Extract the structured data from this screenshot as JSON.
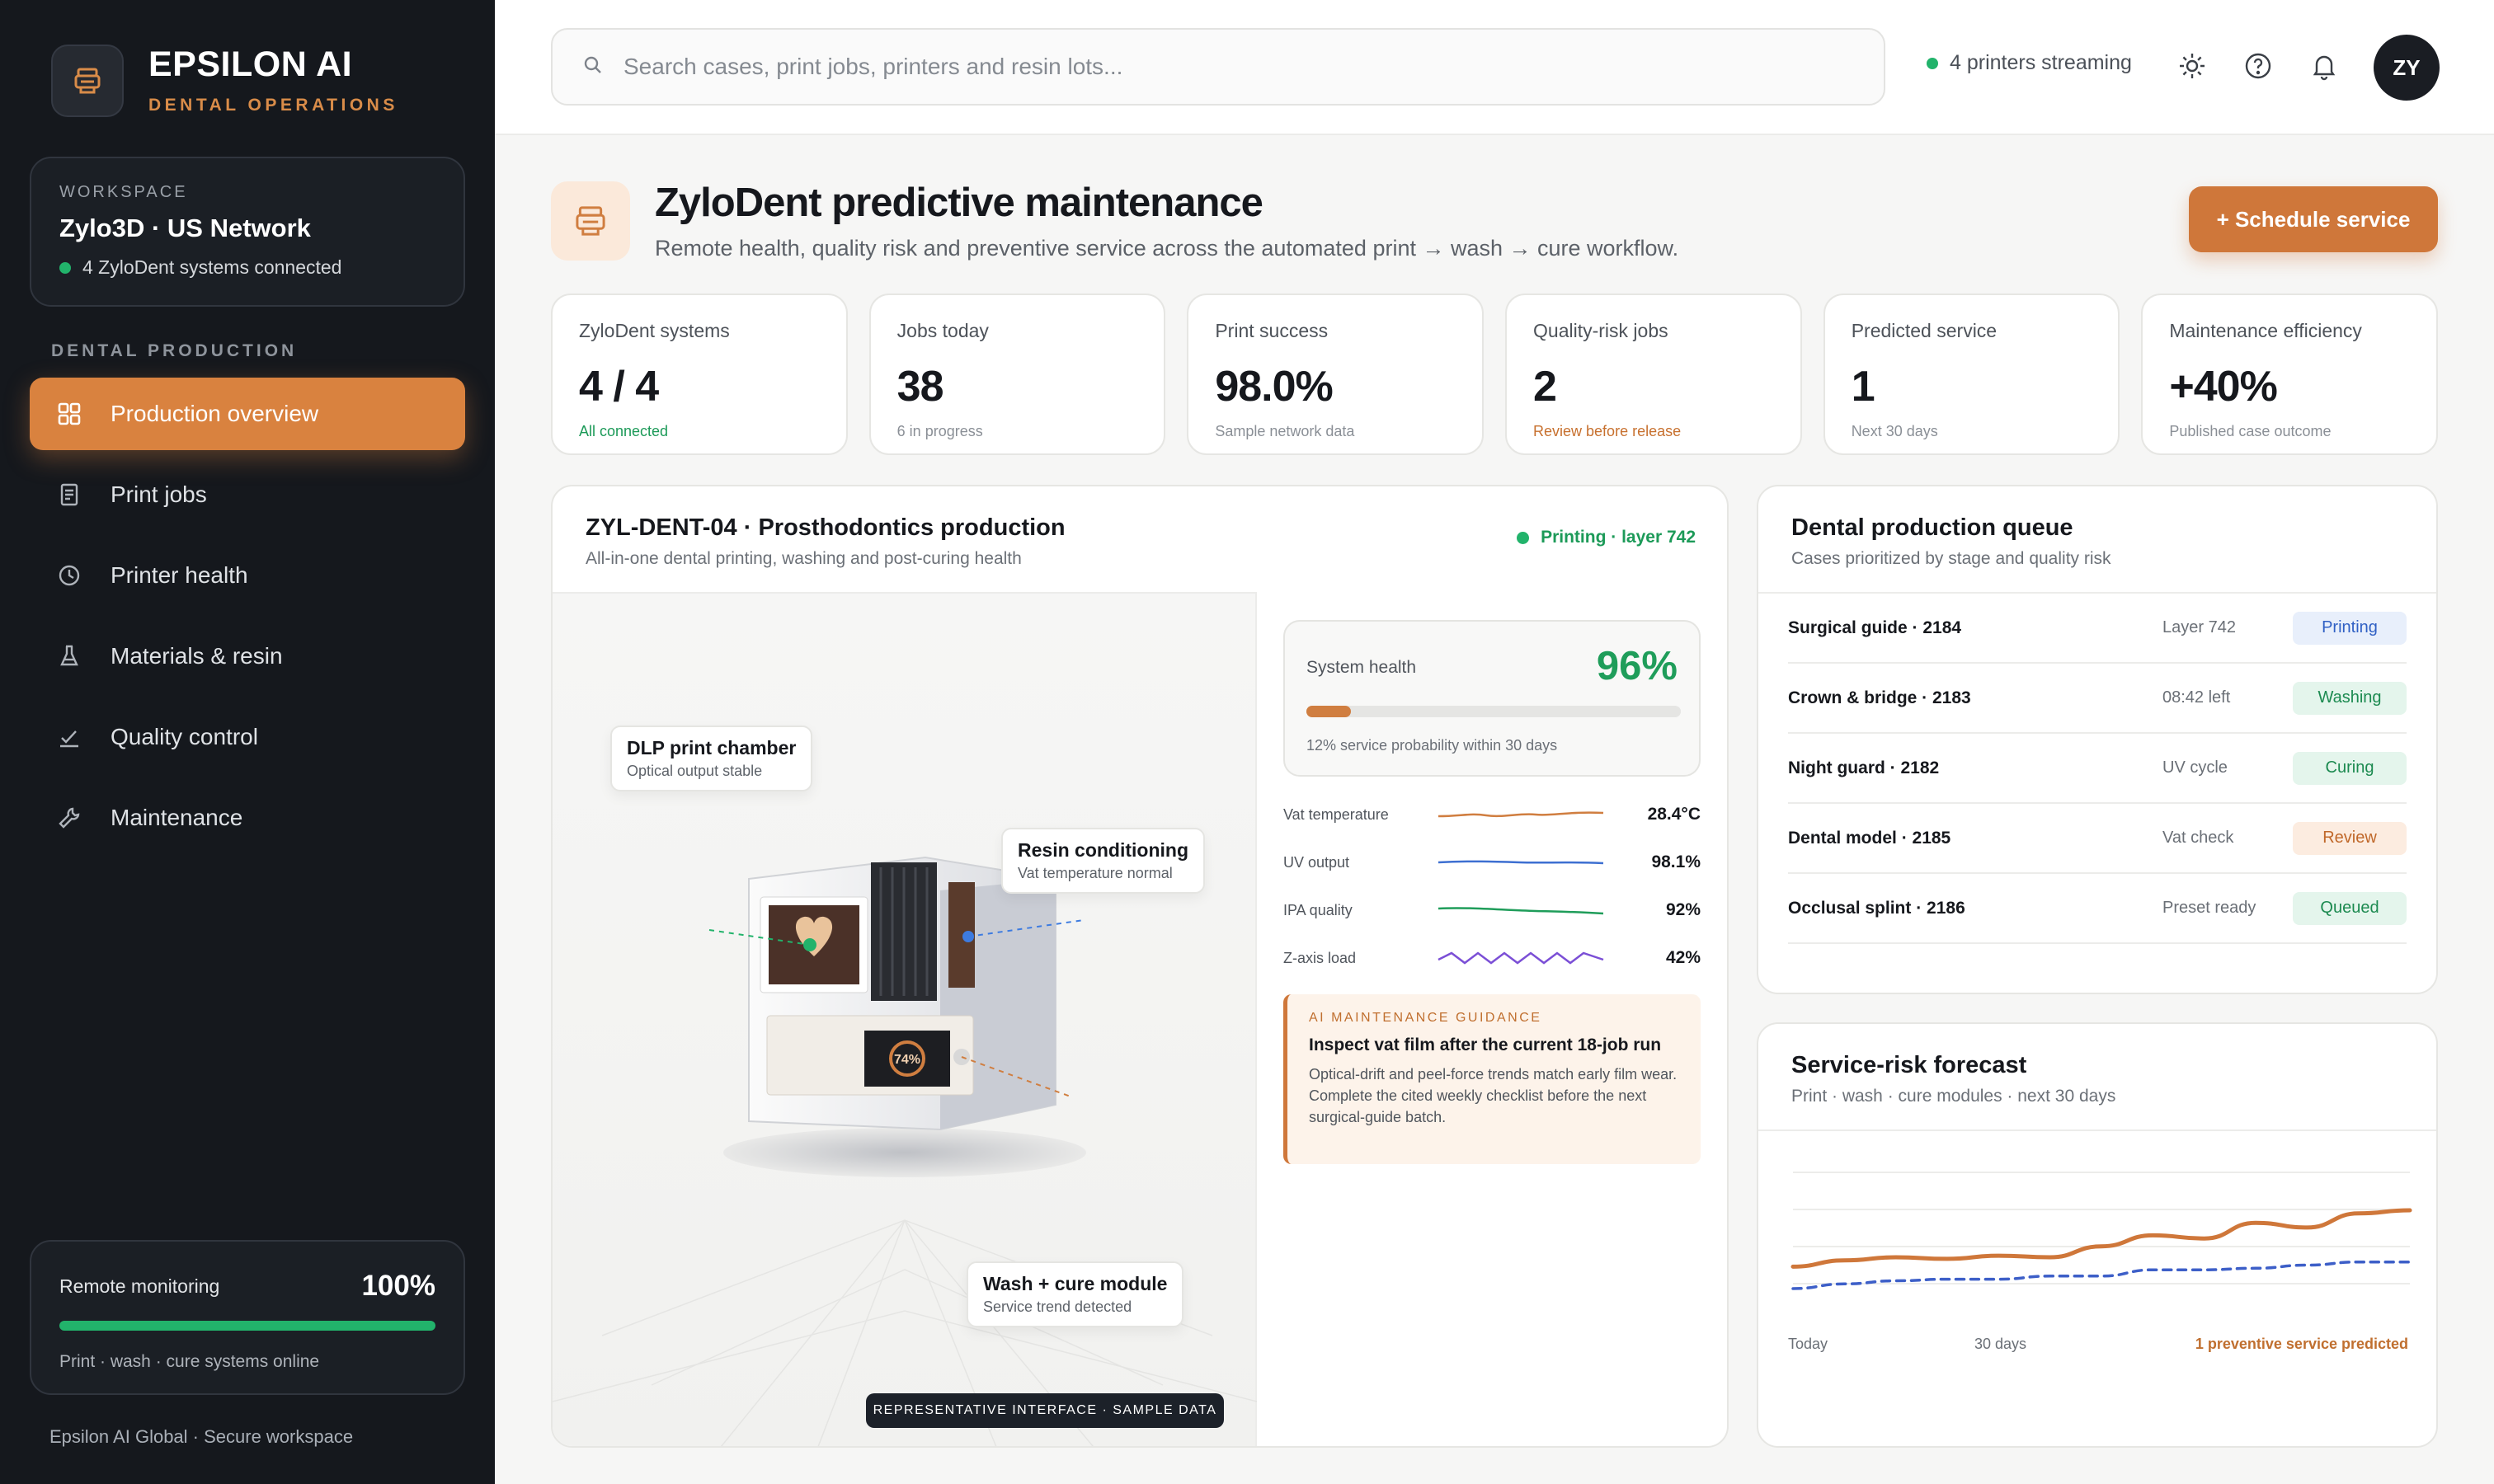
{
  "brand": {
    "name": "EPSILON AI",
    "subtitle": "DENTAL OPERATIONS"
  },
  "workspace": {
    "label": "WORKSPACE",
    "name": "Zylo3D · US Network",
    "status": "4 ZyloDent systems connected"
  },
  "nav": {
    "section": "DENTAL PRODUCTION",
    "items": [
      {
        "label": "Production overview",
        "icon": "grid-icon",
        "active": true
      },
      {
        "label": "Print jobs",
        "icon": "document-icon"
      },
      {
        "label": "Printer health",
        "icon": "clock-icon"
      },
      {
        "label": "Materials & resin",
        "icon": "flask-icon"
      },
      {
        "label": "Quality control",
        "icon": "check-chart-icon"
      },
      {
        "label": "Maintenance",
        "icon": "wrench-icon"
      }
    ]
  },
  "remote": {
    "label": "Remote monitoring",
    "value": "100%",
    "progress": 1.0,
    "sub": "Print · wash · cure systems online"
  },
  "footer": "Epsilon AI Global · Secure workspace",
  "topbar": {
    "search_placeholder": "Search cases, print jobs, printers and resin lots...",
    "stream_status": "4 printers streaming",
    "icons": [
      "sun-icon",
      "help-icon",
      "bell-icon"
    ],
    "avatar": "ZY"
  },
  "header": {
    "title": "ZyloDent predictive maintenance",
    "subtitle": "Remote health, quality risk and preventive service across the automated print → wash → cure workflow.",
    "button": "+ Schedule service"
  },
  "kpis": [
    {
      "label": "ZyloDent systems",
      "value": "4 / 4",
      "note": "All connected",
      "tone": "green"
    },
    {
      "label": "Jobs today",
      "value": "38",
      "note": "6 in progress",
      "tone": "muted"
    },
    {
      "label": "Print success",
      "value": "98.0%",
      "note": "Sample network data",
      "tone": "muted"
    },
    {
      "label": "Quality-risk jobs",
      "value": "2",
      "note": "Review before release",
      "tone": "orange"
    },
    {
      "label": "Predicted service",
      "value": "1",
      "note": "Next 30 days",
      "tone": "muted"
    },
    {
      "label": "Maintenance efficiency",
      "value": "+40%",
      "note": "Published case outcome",
      "tone": "muted"
    }
  ],
  "printer": {
    "title": "ZYL-DENT-04 · Prosthodontics production",
    "subtitle": "All-in-one dental printing, washing and post-curing health",
    "status": "Printing · layer 742",
    "screen_text": "74%",
    "callouts": [
      {
        "title": "DLP print chamber",
        "sub": "Optical output stable"
      },
      {
        "title": "Resin conditioning",
        "sub": "Vat temperature normal"
      },
      {
        "title": "Wash + cure module",
        "sub": "Service trend detected"
      }
    ],
    "tag": "REPRESENTATIVE INTERFACE · SAMPLE DATA",
    "health": {
      "label": "System health",
      "value": "96%",
      "service_probability": 0.12,
      "note": "12% service probability within 30 days"
    },
    "metrics": [
      {
        "label": "Vat temperature",
        "value": "28.4°C",
        "color": "#d07e40"
      },
      {
        "label": "UV output",
        "value": "98.1%",
        "color": "#3d6fd1"
      },
      {
        "label": "IPA quality",
        "value": "92%",
        "color": "#1f9d5a"
      },
      {
        "label": "Z-axis load",
        "value": "42%",
        "color": "#7b4fd6"
      }
    ],
    "guidance": {
      "label": "AI MAINTENANCE GUIDANCE",
      "title": "Inspect vat film after the current 18-job run",
      "body": "Optical-drift and peel-force trends match early film wear. Complete the cited weekly checklist before the next surgical-guide batch."
    }
  },
  "queue": {
    "title": "Dental production queue",
    "subtitle": "Cases prioritized by stage and quality risk",
    "rows": [
      {
        "name": "Surgical guide · 2184",
        "meta": "Layer 742",
        "status": "Printing",
        "tone": "blue"
      },
      {
        "name": "Crown & bridge · 2183",
        "meta": "08:42 left",
        "status": "Washing",
        "tone": "green"
      },
      {
        "name": "Night guard · 2182",
        "meta": "UV cycle",
        "status": "Curing",
        "tone": "green"
      },
      {
        "name": "Dental model · 2185",
        "meta": "Vat check",
        "status": "Review",
        "tone": "orange"
      },
      {
        "name": "Occlusal splint · 2186",
        "meta": "Preset ready",
        "status": "Queued",
        "tone": "green"
      }
    ]
  },
  "forecast": {
    "title": "Service-risk forecast",
    "subtitle": "Print · wash · cure modules · next 30 days",
    "x_start": "Today",
    "x_mid": "30 days",
    "note": "1 preventive service predicted"
  },
  "chart_data": {
    "type": "line",
    "x": [
      0,
      1,
      2,
      3,
      4,
      5,
      6,
      7,
      8,
      9,
      10,
      11,
      12
    ],
    "series": [
      {
        "values": [
          0.24,
          0.28,
          0.3,
          0.29,
          0.31,
          0.3,
          0.37,
          0.44,
          0.42,
          0.52,
          0.49,
          0.58,
          0.6
        ],
        "color": "#cf773a",
        "style": "solid"
      },
      {
        "values": [
          0.1,
          0.13,
          0.15,
          0.16,
          0.16,
          0.18,
          0.18,
          0.22,
          0.22,
          0.23,
          0.25,
          0.27,
          0.27
        ],
        "color": "#3d5fc8",
        "style": "dashed"
      }
    ],
    "ylim": [
      0,
      1
    ],
    "grid": true,
    "colors": {
      "primary": "#cf773a",
      "secondary": "#3d5fc8"
    }
  }
}
